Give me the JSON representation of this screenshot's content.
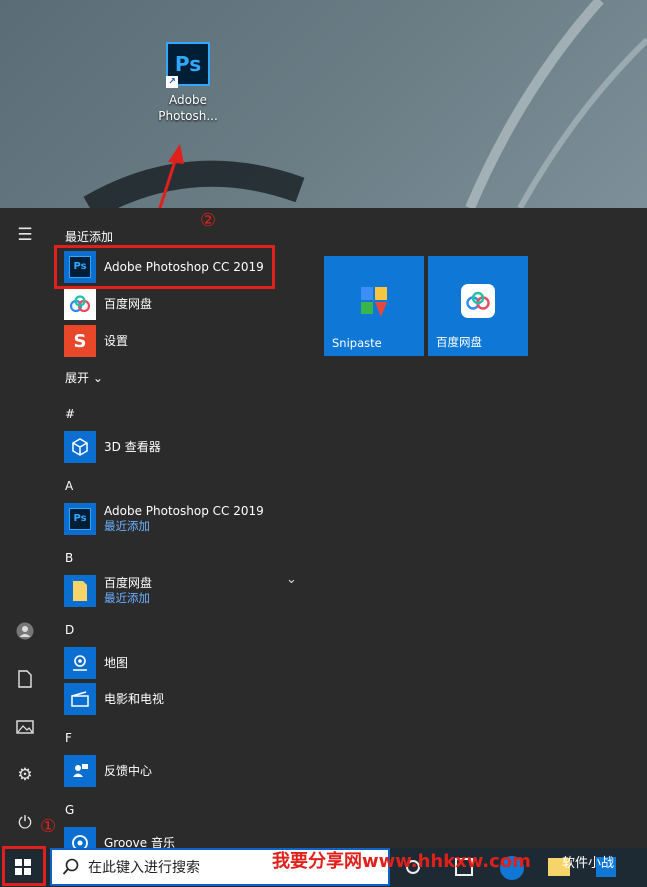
{
  "desktop": {
    "shortcut_icon_text": "Ps",
    "shortcut_label_line1": "Adobe",
    "shortcut_label_line2": "Photosh..."
  },
  "annotations": {
    "step1": "①",
    "step2": "②",
    "watermark": "我要分享网www.hhkxw.com",
    "watermark2": "软件小战"
  },
  "start_menu": {
    "recent_header": "最近添加",
    "recent": [
      {
        "label": "Adobe Photoshop CC 2019",
        "icon": "photoshop-icon"
      },
      {
        "label": "百度网盘",
        "icon": "baidu-netdisk-icon"
      },
      {
        "label": "设置",
        "icon": "settings-s-icon"
      }
    ],
    "expand_label": "展开",
    "sections": [
      {
        "letter": "#"
      },
      {
        "letter": "A"
      },
      {
        "letter": "B"
      },
      {
        "letter": "D"
      },
      {
        "letter": "F"
      },
      {
        "letter": "G"
      }
    ],
    "apps": [
      {
        "label": "3D 查看器",
        "sub": ""
      },
      {
        "label": "Adobe Photoshop CC 2019",
        "sub": "最近添加"
      },
      {
        "label": "百度网盘",
        "sub": "最近添加"
      },
      {
        "label": "地图",
        "sub": ""
      },
      {
        "label": "电影和电视",
        "sub": ""
      },
      {
        "label": "反馈中心",
        "sub": ""
      },
      {
        "label": "Groove 音乐",
        "sub": ""
      }
    ],
    "tiles": [
      {
        "label": "Snipaste"
      },
      {
        "label": "百度网盘"
      }
    ]
  },
  "taskbar": {
    "search_placeholder": "在此键入进行搜索"
  },
  "colors": {
    "accent": "#0f78d7",
    "annotation_red": "#e0201b",
    "menu_bg": "#2b2b2b"
  }
}
